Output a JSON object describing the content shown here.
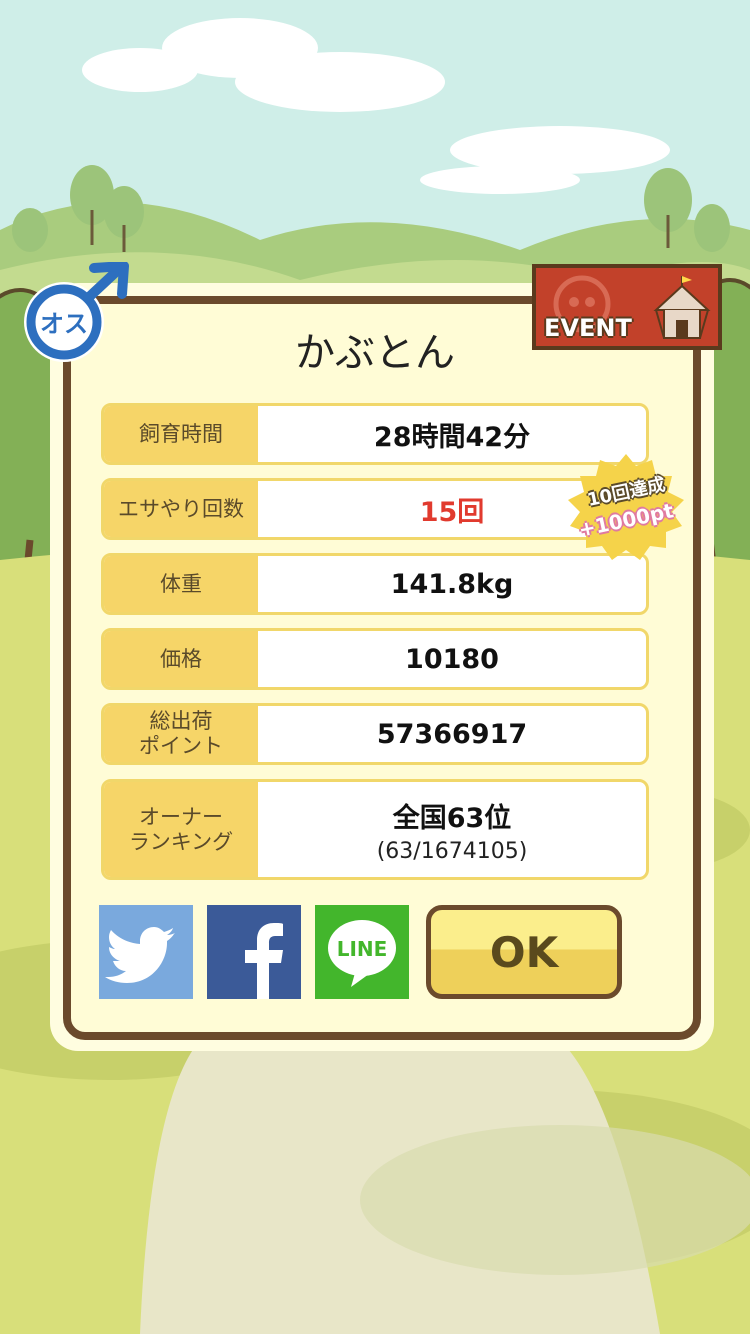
{
  "pet": {
    "name": "かぶとん",
    "sex_label": "オス"
  },
  "event_badge": {
    "label": "EVENT"
  },
  "stats": {
    "breeding_time": {
      "label": "飼育時間",
      "value": "28時間42分"
    },
    "feed_count": {
      "label": "エサやり回数",
      "value": "15回"
    },
    "weight": {
      "label": "体重",
      "value": "141.8kg"
    },
    "price": {
      "label": "価格",
      "value": "10180"
    },
    "total_points": {
      "label_line1": "総出荷",
      "label_line2": "ポイント",
      "value": "57366917"
    },
    "ranking": {
      "label_line1": "オーナー",
      "label_line2": "ランキング",
      "value": "全国63位",
      "detail": "(63/1674105)"
    }
  },
  "achievement": {
    "line1": "10回達成",
    "line2": "+1000pt"
  },
  "share": {
    "twitter_icon": "twitter-bird-icon",
    "facebook_icon": "facebook-f-icon",
    "line_icon": "line-logo-icon",
    "line_label": "LINE"
  },
  "ok_label": "OK",
  "colors": {
    "panel_border": "#6b4a2c",
    "label_bg": "#f6d568",
    "value_red": "#e13a2e",
    "twitter": "#7aa9dd",
    "facebook": "#3b5a98",
    "line": "#43b62c"
  }
}
